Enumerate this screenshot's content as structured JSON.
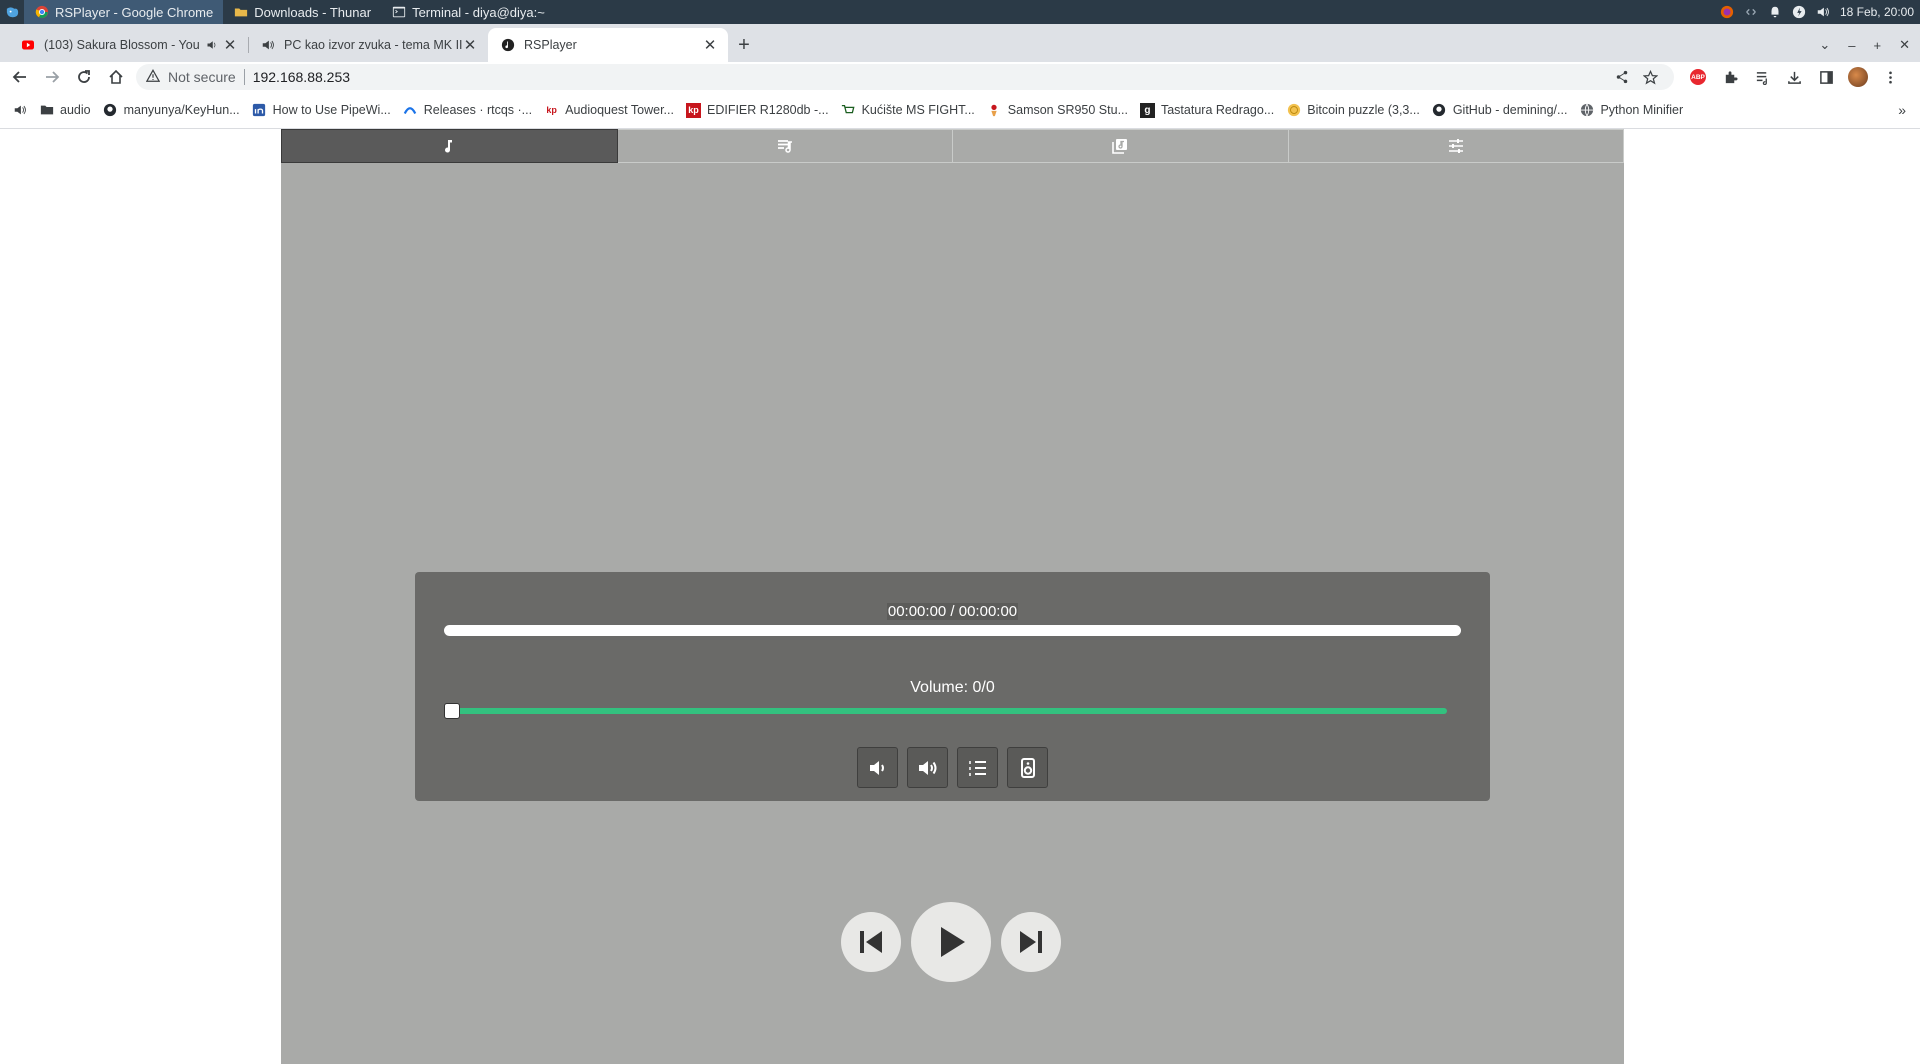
{
  "os": {
    "tasks": [
      {
        "label": "RSPlayer - Google Chrome",
        "icon": "chrome-icon",
        "active": true
      },
      {
        "label": "Downloads - Thunar",
        "icon": "folder-icon",
        "active": false
      },
      {
        "label": "Terminal - diya@diya:~",
        "icon": "terminal-icon",
        "active": false
      }
    ],
    "clock": "18 Feb, 20:00"
  },
  "browser": {
    "tabs": [
      {
        "title": "(103) Sakura Blossom - You",
        "icon": "youtube-icon"
      },
      {
        "title": "PC kao izvor zvuka - tema MK II",
        "icon": "speaker-icon"
      },
      {
        "title": "RSPlayer",
        "icon": "rsplayer-icon"
      }
    ],
    "security": "Not secure",
    "url": "192.168.88.253",
    "bookmarks": [
      {
        "label": "",
        "icon": "speaker-icon"
      },
      {
        "label": "audio",
        "icon": "folder-icon"
      },
      {
        "label": "manyunya/KeyHun...",
        "icon": "github-icon"
      },
      {
        "label": "How to Use PipeWi...",
        "icon": "linkedin-icon"
      },
      {
        "label": "Releases · rtcqs ·...",
        "icon": "releases-icon"
      },
      {
        "label": "Audioquest Tower...",
        "icon": "kp-icon"
      },
      {
        "label": "EDIFIER R1280db -...",
        "icon": "kp-icon"
      },
      {
        "label": "Kućište MS FIGHT...",
        "icon": "cart-icon"
      },
      {
        "label": "Samson SR950 Stu...",
        "icon": "shop-icon"
      },
      {
        "label": "Tastatura Redrago...",
        "icon": "g-icon"
      },
      {
        "label": "Bitcoin puzzle (3,3...",
        "icon": "bitcoin-icon"
      },
      {
        "label": "GitHub - demining/...",
        "icon": "github-icon"
      },
      {
        "label": "Python Minifier",
        "icon": "globe-icon"
      }
    ]
  },
  "player": {
    "time": "00:00:00 / 00:00:00",
    "progress": 0,
    "volume_label": "Volume: 0/0",
    "volume_level": 0,
    "accent_color": "#33c17f"
  }
}
